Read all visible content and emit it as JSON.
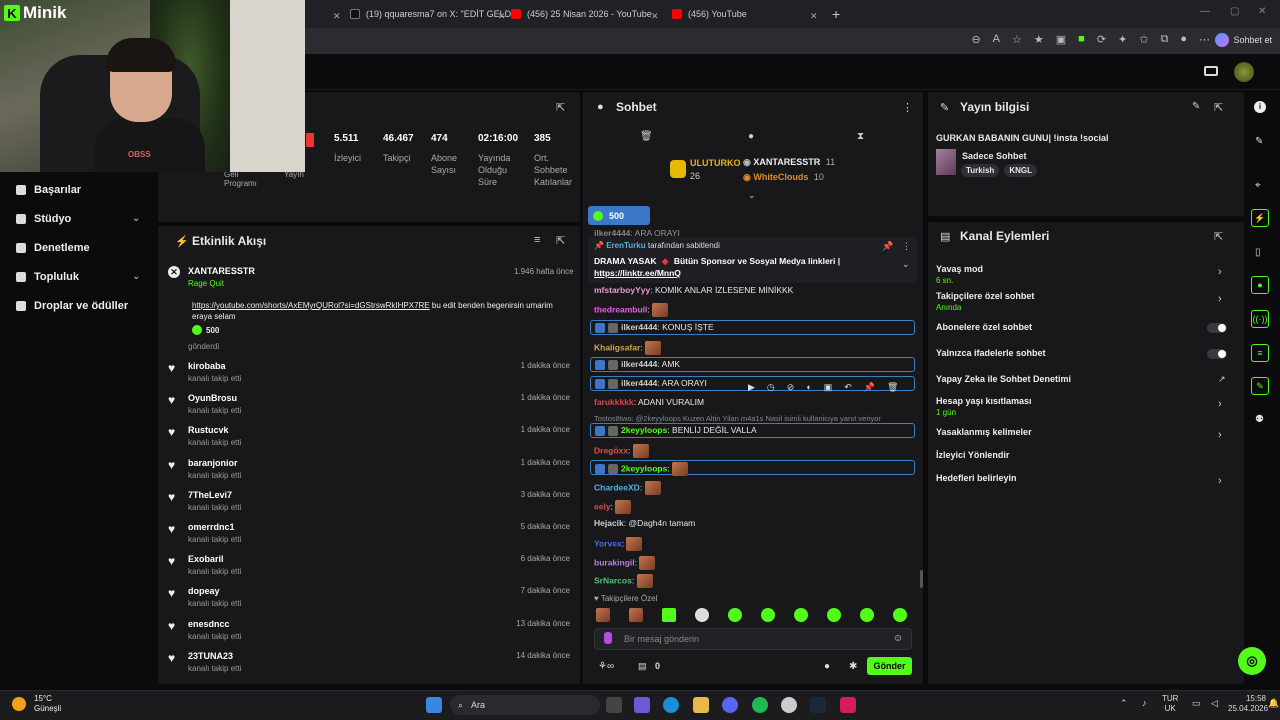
{
  "browser": {
    "tabs": [
      {
        "label": "(19) qquaresma7 on X: \"EDİT GELD",
        "color": "#111"
      },
      {
        "label": "(456) 25 Nisan 2026 - YouTube",
        "color": "#ff0000"
      },
      {
        "label": "(456) YouTube",
        "color": "#ff0000"
      }
    ],
    "new_tab": "+",
    "chat_button": "Sohbet et"
  },
  "webcam": {
    "brand": "Minik",
    "shirt": "OBSS"
  },
  "sidebar": {
    "items": [
      {
        "label": "Başarılar"
      },
      {
        "label": "Stüdyo"
      },
      {
        "label": "Denetleme"
      },
      {
        "label": "Topluluk"
      },
      {
        "label": "Droplar ve ödüller"
      }
    ]
  },
  "stats": {
    "partial_labels": [
      "Geli Programı",
      "Yayın"
    ],
    "items": [
      {
        "value": "5.511",
        "label": "İzleyici"
      },
      {
        "value": "46.467",
        "label": "Takipçi"
      },
      {
        "value": "474",
        "label": "Abone Sayısı"
      },
      {
        "value": "02:16:00",
        "label": "Yayında Olduğu Süre"
      },
      {
        "value": "385",
        "label": "Ort. Sohbete Katılanlar"
      }
    ]
  },
  "activity": {
    "title": "Etkinlik Akışı",
    "gift": {
      "name": "XANTARESSTR",
      "sub": "Rage Quit",
      "time": "1.946 hafta önce",
      "link": "https://youtube.com/shorts/AxEMyrQURol?si=dGStrswRkIHPX7RE",
      "text": "bu edit benden begenirsin umarim eraya selam",
      "amount": "500",
      "sent": "gönderdi"
    },
    "follows": [
      {
        "name": "kirobaba",
        "sub": "kanalı takip etti",
        "time": "1 dakika önce"
      },
      {
        "name": "OyunBrosu",
        "sub": "kanalı takip etti",
        "time": "1 dakika önce"
      },
      {
        "name": "Rustucvk",
        "sub": "kanalı takip etti",
        "time": "1 dakika önce"
      },
      {
        "name": "baranjonior",
        "sub": "kanalı takip etti",
        "time": "1 dakika önce"
      },
      {
        "name": "7TheLevi7",
        "sub": "kanalı takip etti",
        "time": "3 dakika önce"
      },
      {
        "name": "omerrdnc1",
        "sub": "kanalı takip etti",
        "time": "5 dakika önce"
      },
      {
        "name": "Exobaril",
        "sub": "kanalı takip etti",
        "time": "6 dakika önce"
      },
      {
        "name": "dopeay",
        "sub": "kanalı takip etti",
        "time": "7 dakika önce"
      },
      {
        "name": "enesdncc",
        "sub": "kanalı takip etti",
        "time": "13 dakika önce"
      },
      {
        "name": "23TUNA23",
        "sub": "kanalı takip etti",
        "time": "14 dakika önce"
      }
    ]
  },
  "chat": {
    "title": "Sohbet",
    "leaderboard": [
      {
        "name": "ULUTURKO",
        "count": "26"
      },
      {
        "name": "XANTARESSTR",
        "count": "11"
      },
      {
        "name": "WhiteClouds",
        "count": "10"
      }
    ],
    "pill_amount": "500",
    "pinned_by": "ErenTurku",
    "pinned_by_suffix": "tarafından sabitlendi",
    "pinned_text": "DRAMA YASAK",
    "pinned_text2": "Bütün Sponsor ve Sosyal Medya linkleri |",
    "pinned_link": "https://linktr.ee/MnnQ",
    "messages": [
      {
        "user": "ilker4444",
        "text": "ARA ORAYI",
        "color": "#cfcfcf",
        "mod": false
      },
      {
        "user": "mfstarboyYyy",
        "text": "KOMİK ANLAR İZLESENE MİNİKKK",
        "color": "#e79ad6",
        "mod": false
      },
      {
        "user": "thedreambull",
        "text": "",
        "color": "#e061e0",
        "mod": false,
        "emote": true
      },
      {
        "user": "ilker4444",
        "text": "KONUŞ İŞTE",
        "color": "#cfcfcf",
        "mod": true
      },
      {
        "user": "Khaligsafar",
        "text": "",
        "color": "#d4a54a",
        "mod": false,
        "emote": true
      },
      {
        "user": "ilker4444",
        "text": "AMK",
        "color": "#cfcfcf",
        "mod": true
      },
      {
        "user": "ilker4444",
        "text": "ARA ORAYI",
        "color": "#cfcfcf",
        "mod": true
      },
      {
        "user": "farukkkkk",
        "text": "ADANI VURALIM",
        "color": "#d54848",
        "mod": false
      },
      {
        "user": "2keyyloops",
        "text": "BENLİJ DEĞİL VALLA",
        "color": "#53fc18",
        "mod": true
      },
      {
        "user": "Dregöxx",
        "text": "",
        "color": "#e05050",
        "mod": false,
        "emote": true
      },
      {
        "user": "2keyyloops",
        "text": "",
        "color": "#53fc18",
        "mod": true,
        "emote": true
      },
      {
        "user": "ChardeeXD",
        "text": "",
        "color": "#4ab3e0",
        "mod": false,
        "emote": true
      },
      {
        "user": "eely",
        "text": "",
        "color": "#d54848",
        "mod": false,
        "emote": true
      },
      {
        "user": "Hejacik",
        "text": "@Dagh4n tamam",
        "color": "#cfcfcf",
        "mod": false
      },
      {
        "user": "Yorvex",
        "text": "",
        "color": "#4a6ef0",
        "mod": false,
        "emote": true
      },
      {
        "user": "burakingil",
        "text": "",
        "color": "#c07ae0",
        "mod": false,
        "emote": true
      },
      {
        "user": "SrNarcos",
        "text": "",
        "color": "#53c07a",
        "mod": false,
        "emote": true
      }
    ],
    "reply_preview": "Tostos8two: @2keyyloops Kuzen Altin Yilan m4a1s Nasil isimli kullanicıya yanıt veriyor",
    "followers_only": "Takipçilere Özel",
    "placeholder": "Bir mesaj gönderin",
    "viewer_count": "0",
    "send": "Gönder"
  },
  "info": {
    "title": "Yayın bilgisi",
    "stream_title": "GURKAN BABANIN GUNU| !insta !social",
    "category": "Sadece Sohbet",
    "tags": [
      "Turkish",
      "KNGL"
    ]
  },
  "actions": {
    "title": "Kanal Eylemleri",
    "items": [
      {
        "label": "Yavaş mod",
        "sub": "6 sn."
      },
      {
        "label": "Takipçilere özel sohbet",
        "sub": "Anında"
      },
      {
        "label": "Abonelere özel sohbet",
        "sub": ""
      },
      {
        "label": "Yalnızca ifadelerle sohbet",
        "sub": ""
      },
      {
        "label": "Yapay Zeka ile Sohbet Denetimi",
        "sub": ""
      },
      {
        "label": "Hesap yaşı kısıtlaması",
        "sub": "1 gün"
      },
      {
        "label": "Yasaklanmış kelimeler",
        "sub": ""
      },
      {
        "label": "İzleyici Yönlendir",
        "sub": ""
      },
      {
        "label": "Hedefleri belirleyin",
        "sub": ""
      }
    ]
  },
  "taskbar": {
    "weather_temp": "15°C",
    "weather_desc": "Güneşli",
    "search": "Ara",
    "lang1": "TUR",
    "lang2": "UK",
    "time": "15:58",
    "date": "25.04.2026"
  },
  "colors": {
    "accent": "#53fc18",
    "panel": "#18181b",
    "bg": "#0b0b0d"
  }
}
